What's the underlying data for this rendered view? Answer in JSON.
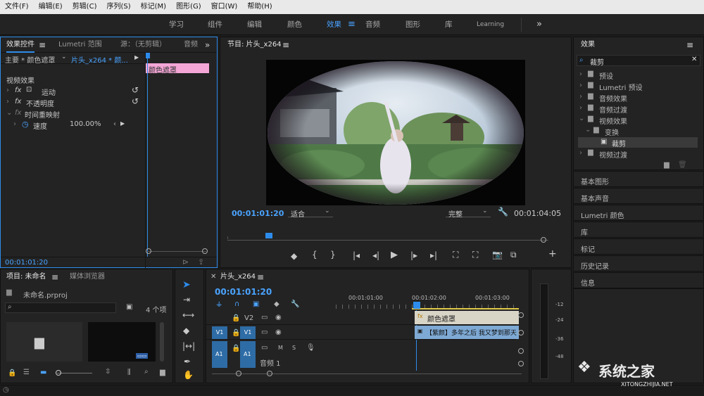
{
  "menu": [
    "文件(F)",
    "编辑(E)",
    "剪辑(C)",
    "序列(S)",
    "标记(M)",
    "图形(G)",
    "窗口(W)",
    "帮助(H)"
  ],
  "workspaces": {
    "items": [
      "学习",
      "组件",
      "编辑",
      "颜色",
      "效果",
      "音频",
      "图形",
      "库",
      "Learning"
    ],
    "active": "效果",
    "more": "»"
  },
  "effect_controls": {
    "tabs": [
      "效果控件",
      "Lumetri 范围",
      "源：（无剪辑）",
      "音频"
    ],
    "master_label": "主要 * 颜色遮罩",
    "clip_label": "片头_x264 * 颜...",
    "clip_bar_label": "颜色遮罩",
    "section": "视频效果",
    "rows": [
      {
        "label": "运动",
        "fx": "fx"
      },
      {
        "label": "不透明度",
        "fx": "fx"
      },
      {
        "label": "时间重映射",
        "fx": "fx"
      }
    ],
    "speed": {
      "label": "速度",
      "value": "100.00%"
    },
    "timecode": "00:01:01:20"
  },
  "program": {
    "title": "节目: 片头_x264",
    "timecode_left": "00:01:01:20",
    "fit": "适合",
    "quality": "完整",
    "timecode_right": "00:01:04:05"
  },
  "effects_panel": {
    "title": "效果",
    "search_value": "裁剪",
    "tree": [
      {
        "label": "预设",
        "level": 0,
        "open": false
      },
      {
        "label": "Lumetri 预设",
        "level": 0,
        "open": false
      },
      {
        "label": "音频效果",
        "level": 0,
        "open": false
      },
      {
        "label": "音频过渡",
        "level": 0,
        "open": false
      },
      {
        "label": "视频效果",
        "level": 0,
        "open": true
      },
      {
        "label": "变换",
        "level": 1,
        "open": true
      },
      {
        "label": "裁剪",
        "level": 2,
        "selected": true
      },
      {
        "label": "视频过渡",
        "level": 0,
        "open": false
      }
    ],
    "panels": [
      "基本图形",
      "基本声音",
      "Lumetri 颜色",
      "库",
      "标记",
      "历史记录",
      "信息"
    ]
  },
  "project": {
    "tabs": [
      "项目: 未命名",
      "媒体浏览器"
    ],
    "file": "未命名.prproj",
    "count": "4 个项"
  },
  "timeline": {
    "title": "片头_x264",
    "timecode": "00:01:01:20",
    "ruler": [
      "00:01:01:00",
      "00:01:02:00",
      "00:01:03:00"
    ],
    "tracks": [
      {
        "name": "V2",
        "target": ""
      },
      {
        "name": "V1",
        "target": "V1"
      },
      {
        "name": "A1",
        "target": "A1",
        "label": "音频 1"
      }
    ],
    "clip_v2": "颜色遮罩",
    "clip_v1": "【紫颜】多年之后 我又梦到那天",
    "a1_buttons": [
      "M",
      "S"
    ]
  },
  "meter_ticks": [
    "-12",
    "-24",
    "-36",
    "-48"
  ],
  "watermark": {
    "name": "系统之家",
    "url": "XITONGZHIJIA.NET"
  },
  "colors": {
    "accent": "#2d8ceb",
    "pink_clip": "#f4a6d7",
    "video_clip": "#7ea9d4",
    "matte_clip": "#d8d4c6"
  }
}
